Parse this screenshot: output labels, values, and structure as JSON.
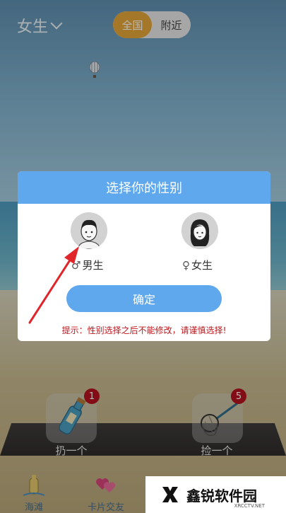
{
  "header": {
    "gender_filter": "女生",
    "scope_active": "全国",
    "scope_inactive": "附近"
  },
  "dialog": {
    "title": "选择你的性别",
    "male_label": "男生",
    "female_label": "女生",
    "confirm_label": "确定",
    "hint": "提示：性别选择之后不能修改，请谨慎选择!"
  },
  "actions": {
    "throw_label": "扔一个",
    "throw_count": "1",
    "pick_label": "捡一个",
    "pick_count": "5"
  },
  "tabs": [
    {
      "label": "海滩"
    },
    {
      "label": "卡片交友"
    }
  ],
  "watermark": {
    "text": "鑫锐软件园",
    "sub": "XRCCTV.NET"
  },
  "colors": {
    "accent_blue": "#5fa8ee",
    "scope_orange": "#e5a63a",
    "hint_red": "#c0151b",
    "badge_red": "#b4121f"
  }
}
